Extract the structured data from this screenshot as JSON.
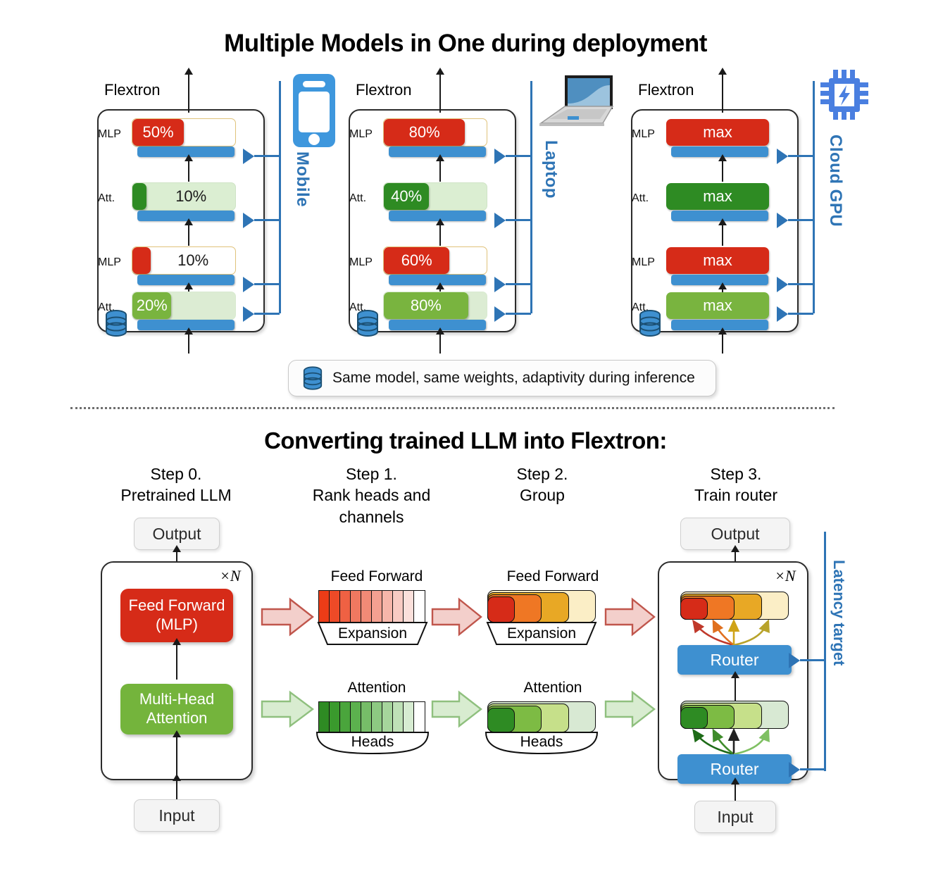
{
  "titles": {
    "top": "Multiple Models in One during deployment",
    "bottom": "Converting trained LLM into Flextron:"
  },
  "deployment": {
    "box_label": "Flextron",
    "layer_tags": {
      "mlp": "MLP",
      "att": "Att."
    },
    "devices": [
      {
        "name": "Mobile",
        "icon": "mobile-phone-icon",
        "layers": [
          {
            "type": "MLP",
            "value": "50%",
            "fill_pct": 50,
            "label_inside": true
          },
          {
            "type": "Att.",
            "value": "10%",
            "fill_pct": 14,
            "label_inside": false
          },
          {
            "type": "MLP",
            "value": "10%",
            "fill_pct": 18,
            "label_inside": false
          },
          {
            "type": "Att.",
            "value": "20%",
            "fill_pct": 38,
            "label_inside": true
          }
        ]
      },
      {
        "name": "Laptop",
        "icon": "laptop-icon",
        "layers": [
          {
            "type": "MLP",
            "value": "80%",
            "fill_pct": 79,
            "label_inside": true
          },
          {
            "type": "Att.",
            "value": "40%",
            "fill_pct": 44,
            "label_inside": true
          },
          {
            "type": "MLP",
            "value": "60%",
            "fill_pct": 64,
            "label_inside": true
          },
          {
            "type": "Att.",
            "value": "80%",
            "fill_pct": 82,
            "label_inside": true
          }
        ]
      },
      {
        "name": "Cloud GPU",
        "icon": "gpu-chip-icon",
        "layers": [
          {
            "type": "MLP",
            "value": "max",
            "fill_pct": 100,
            "label_inside": true
          },
          {
            "type": "Att.",
            "value": "max",
            "fill_pct": 100,
            "label_inside": true
          },
          {
            "type": "MLP",
            "value": "max",
            "fill_pct": 100,
            "label_inside": true
          },
          {
            "type": "Att.",
            "value": "max",
            "fill_pct": 100,
            "label_inside": true
          }
        ]
      }
    ],
    "legend": {
      "icon": "database-icon",
      "text": "Same model, same weights, adaptivity during inference"
    }
  },
  "conversion": {
    "steps": [
      {
        "id": 0,
        "heading": "Step 0.\nPretrained LLM"
      },
      {
        "id": 1,
        "heading": "Step 1.\nRank heads and\nchannels"
      },
      {
        "id": 2,
        "heading": "Step 2.\nGroup"
      },
      {
        "id": 3,
        "heading": "Step 3.\nTrain router"
      }
    ],
    "step0": {
      "output": "Output",
      "input": "Input",
      "repeat": "×N",
      "feed_forward": "Feed Forward\n(MLP)",
      "attention": "Multi-Head\nAttention"
    },
    "step1": {
      "ff_title": "Feed Forward",
      "ff_axis": "Expansion",
      "att_title": "Attention",
      "att_axis": "Heads",
      "ff_segments": [
        "#ec3c17",
        "#ee4a27",
        "#ef6143",
        "#f07860",
        "#f28a76",
        "#f4a091",
        "#f6b6aa",
        "#f8cbc3",
        "#fbe0db",
        "#ffffff"
      ],
      "att_segments": [
        "#2e8b23",
        "#3a9a2d",
        "#4aa53c",
        "#5cb14e",
        "#76bd68",
        "#8dc982",
        "#a6d59c",
        "#bfe1b7",
        "#d7ecd2",
        "#ffffff"
      ]
    },
    "step2": {
      "ff_title": "Feed Forward",
      "ff_axis": "Expansion",
      "att_title": "Attention",
      "att_axis": "Heads",
      "ff_groups": [
        "#d62b18",
        "#ef7724",
        "#e8a825",
        "#fbeec6"
      ],
      "att_groups": [
        "#2e8b23",
        "#7dbb44",
        "#c6e08a",
        "#d8e9d3"
      ]
    },
    "step3": {
      "output": "Output",
      "input": "Input",
      "repeat": "×N",
      "router": "Router",
      "latency_target": "Latency target",
      "ff_groups": [
        "#d62b18",
        "#ef7724",
        "#e8a825",
        "#fbeec6"
      ],
      "att_groups": [
        "#2e8b23",
        "#7dbb44",
        "#c6e08a",
        "#d8e9d3"
      ]
    }
  },
  "colors": {
    "blue": "#2e74b5",
    "router_blue": "#3e90d0",
    "red": "#d62b18",
    "green_dark": "#2e8b23",
    "green_light": "#79b43f"
  }
}
